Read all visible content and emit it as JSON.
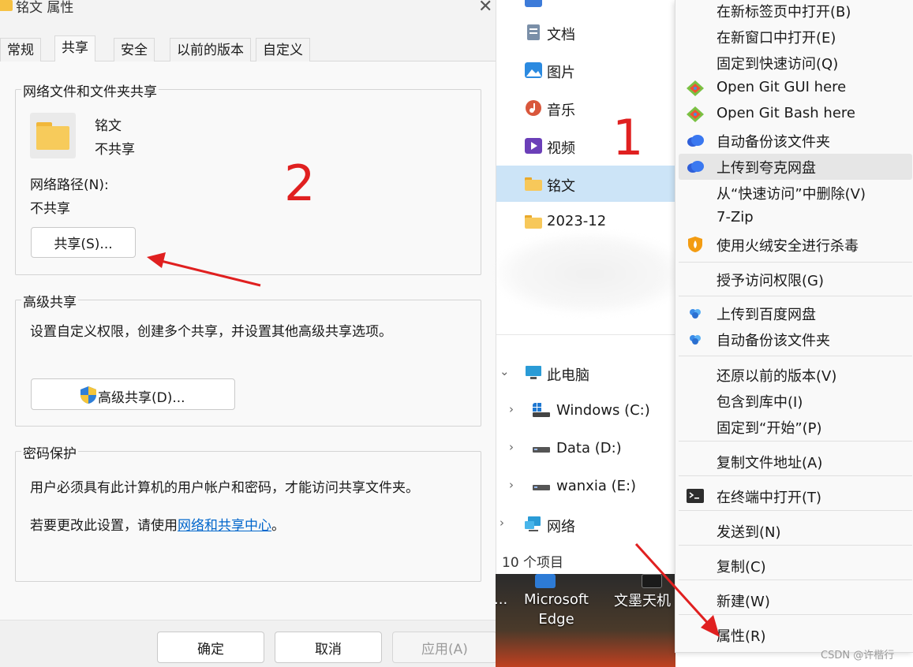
{
  "dialog": {
    "title": "铭文 属性",
    "tabs": [
      "常规",
      "共享",
      "安全",
      "以前的版本",
      "自定义"
    ],
    "active_tab": "共享",
    "sharing_group": {
      "legend": "网络文件和文件夹共享",
      "folder_name": "铭文",
      "folder_status": "不共享",
      "path_label": "网络路径(N):",
      "path_value": "不共享",
      "share_button": "共享(S)..."
    },
    "advanced_group": {
      "legend": "高级共享",
      "description": "设置自定义权限，创建多个共享，并设置其他高级共享选项。",
      "button": "高级共享(D)..."
    },
    "password_group": {
      "legend": "密码保护",
      "line1": "用户必须具有此计算机的用户帐户和密码，才能访问共享文件夹。",
      "line2_prefix": "若要更改此设置，请使用",
      "line2_link": "网络和共享中心",
      "line2_suffix": "。"
    },
    "footer": {
      "ok": "确定",
      "cancel": "取消",
      "apply": "应用(A)"
    }
  },
  "nav": {
    "items": [
      {
        "label": "文档",
        "icon": "document-icon"
      },
      {
        "label": "图片",
        "icon": "pictures-icon"
      },
      {
        "label": "音乐",
        "icon": "music-icon"
      },
      {
        "label": "视频",
        "icon": "video-icon"
      },
      {
        "label": "铭文",
        "icon": "folder-icon",
        "selected": true
      },
      {
        "label": "2023-12",
        "icon": "folder-icon"
      }
    ],
    "tree": [
      {
        "label": "此电脑",
        "icon": "this-pc-icon",
        "chevron": "⌄"
      },
      {
        "label": "Windows (C:)",
        "icon": "windows-drive-icon",
        "chevron": "›"
      },
      {
        "label": "Data (D:)",
        "icon": "drive-icon",
        "chevron": "›"
      },
      {
        "label": "wanxia (E:)",
        "icon": "drive-icon",
        "chevron": "›"
      },
      {
        "label": "网络",
        "icon": "network-icon",
        "chevron": "›"
      }
    ],
    "count": "10 个项目"
  },
  "desktop": {
    "icon1": "Microsoft\nEdge",
    "icon2": "文墨天机",
    "ellipsis": "..."
  },
  "annotations": {
    "n1": "1",
    "n2": "2",
    "arrow_color": "#e02020"
  },
  "context_menu": {
    "groups": [
      [
        {
          "label": "在新标签页中打开(B)",
          "icon": ""
        },
        {
          "label": "在新窗口中打开(E)",
          "icon": ""
        },
        {
          "label": "固定到快速访问(Q)",
          "icon": ""
        },
        {
          "label": "Open Git GUI here",
          "icon": "git-icon"
        },
        {
          "label": "Open Git Bash here",
          "icon": "git-icon"
        },
        {
          "label": "自动备份该文件夹",
          "icon": "quark-cloud-icon"
        },
        {
          "label": "上传到夸克网盘",
          "icon": "quark-cloud-icon",
          "highlighted": true
        },
        {
          "label": "从“快速访问”中删除(V)",
          "icon": ""
        },
        {
          "label": "7-Zip",
          "icon": ""
        },
        {
          "label": "使用火绒安全进行杀毒",
          "icon": "huorong-shield-icon"
        }
      ],
      [
        {
          "label": "授予访问权限(G)",
          "icon": ""
        }
      ],
      [
        {
          "label": "上传到百度网盘",
          "icon": "baidu-cloud-icon"
        },
        {
          "label": "自动备份该文件夹",
          "icon": "baidu-cloud-icon"
        }
      ],
      [
        {
          "label": "还原以前的版本(V)",
          "icon": ""
        },
        {
          "label": "包含到库中(I)",
          "icon": ""
        },
        {
          "label": "固定到“开始”(P)",
          "icon": ""
        }
      ],
      [
        {
          "label": "复制文件地址(A)",
          "icon": ""
        }
      ],
      [
        {
          "label": "在终端中打开(T)",
          "icon": "terminal-icon"
        }
      ],
      [
        {
          "label": "发送到(N)",
          "icon": ""
        }
      ],
      [
        {
          "label": "复制(C)",
          "icon": ""
        }
      ],
      [
        {
          "label": "新建(W)",
          "icon": ""
        }
      ],
      [
        {
          "label": "属性(R)",
          "icon": ""
        }
      ]
    ]
  },
  "watermark": "CSDN @许楷行"
}
